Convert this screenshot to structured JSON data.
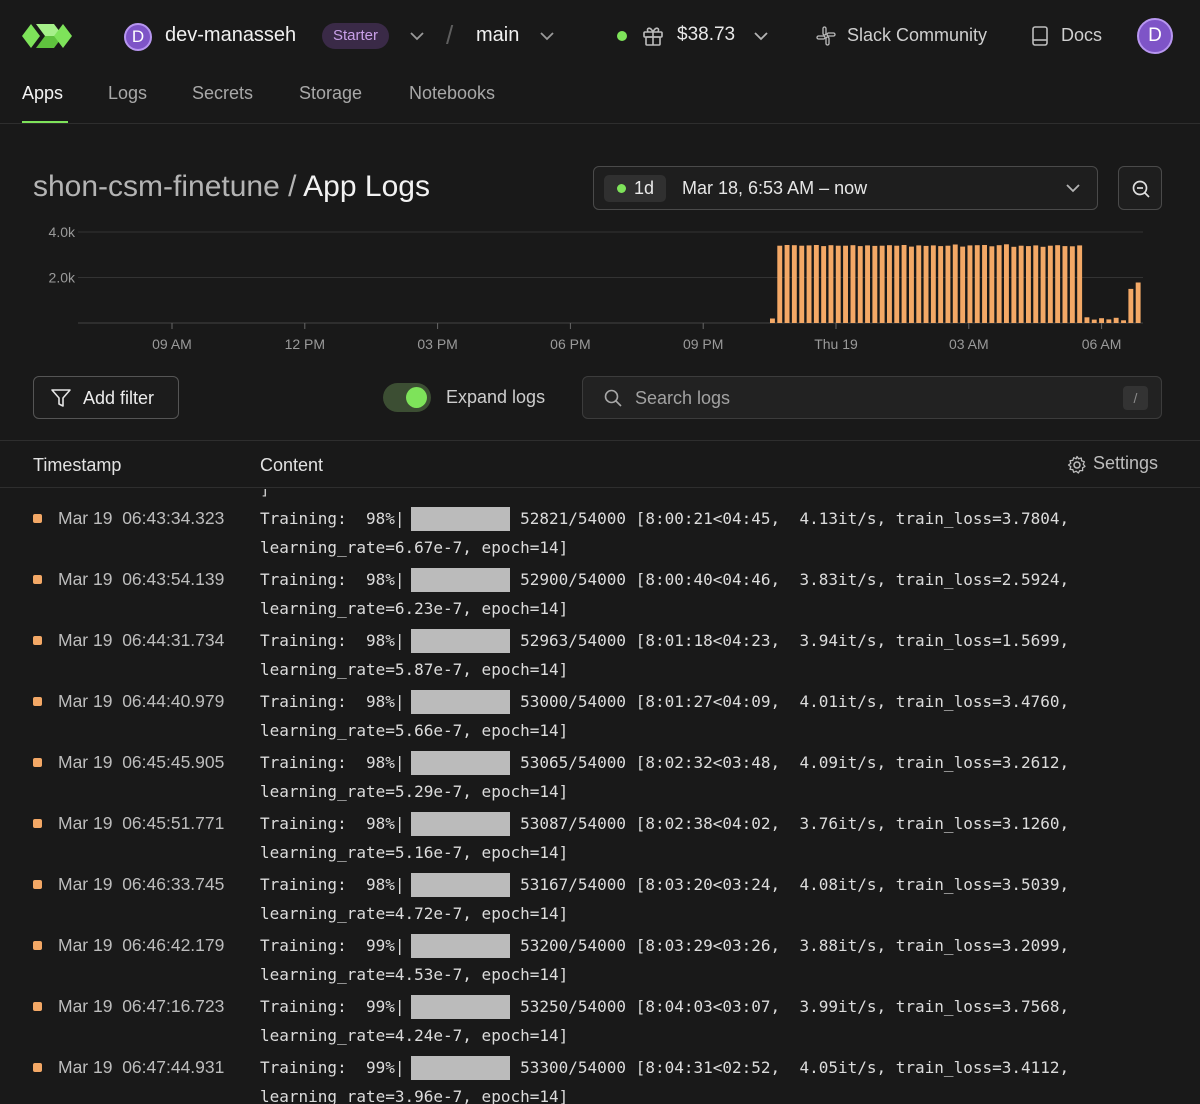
{
  "workspace": {
    "initial": "D",
    "name": "dev-manasseh",
    "plan_badge": "Starter"
  },
  "environment": {
    "separator": "/",
    "name": "main"
  },
  "credits": "$38.73",
  "links": {
    "slack": "Slack Community",
    "docs": "Docs"
  },
  "user": {
    "initial": "D"
  },
  "tabs": [
    "Apps",
    "Logs",
    "Secrets",
    "Storage",
    "Notebooks"
  ],
  "active_tab": "Apps",
  "page": {
    "app_name": "shon-csm-finetune",
    "separator": "/",
    "section": "App Logs"
  },
  "time_range": {
    "preset": "1d",
    "label": "Mar 18, 6:53 AM – now"
  },
  "chart_data": {
    "type": "bar",
    "y_ticks": [
      "4.0k",
      "2.0k"
    ],
    "x_ticks": [
      "09 AM",
      "12 PM",
      "03 PM",
      "06 PM",
      "09 PM",
      "Thu 19",
      "03 AM",
      "06 AM"
    ],
    "ylim": [
      0,
      4000
    ],
    "values": [
      200,
      3400,
      3430,
      3420,
      3400,
      3410,
      3430,
      3380,
      3420,
      3400,
      3400,
      3420,
      3380,
      3410,
      3390,
      3400,
      3420,
      3400,
      3430,
      3360,
      3410,
      3390,
      3410,
      3380,
      3400,
      3450,
      3360,
      3410,
      3420,
      3430,
      3370,
      3420,
      3460,
      3350,
      3400,
      3380,
      3410,
      3350,
      3400,
      3420,
      3380,
      3370,
      3410,
      250,
      150,
      210,
      160,
      230,
      120,
      1500,
      1780
    ],
    "color": "#f3a866",
    "grid": true
  },
  "filter": {
    "add_filter": "Add filter",
    "expand_logs": "Expand logs",
    "expand_on": true,
    "search_placeholder": "Search logs",
    "search_shortcut": "/"
  },
  "table": {
    "col_timestamp": "Timestamp",
    "col_content": "Content",
    "settings": "Settings"
  },
  "partial_line": "                                      ]",
  "logs": [
    {
      "ts": "Mar 19  06:43:34.323",
      "l1": "Training:  98%|          | 52821/54000 [8:00:21<04:45,  4.13it/s, train_loss=3.7804,",
      "l2": "learning_rate=6.67e-7, epoch=14]"
    },
    {
      "ts": "Mar 19  06:43:54.139",
      "l1": "Training:  98%|          | 52900/54000 [8:00:40<04:46,  3.83it/s, train_loss=2.5924,",
      "l2": "learning_rate=6.23e-7, epoch=14]"
    },
    {
      "ts": "Mar 19  06:44:31.734",
      "l1": "Training:  98%|          | 52963/54000 [8:01:18<04:23,  3.94it/s, train_loss=1.5699,",
      "l2": "learning_rate=5.87e-7, epoch=14]"
    },
    {
      "ts": "Mar 19  06:44:40.979",
      "l1": "Training:  98%|          | 53000/54000 [8:01:27<04:09,  4.01it/s, train_loss=3.4760,",
      "l2": "learning_rate=5.66e-7, epoch=14]"
    },
    {
      "ts": "Mar 19  06:45:45.905",
      "l1": "Training:  98%|          | 53065/54000 [8:02:32<03:48,  4.09it/s, train_loss=3.2612,",
      "l2": "learning_rate=5.29e-7, epoch=14]"
    },
    {
      "ts": "Mar 19  06:45:51.771",
      "l1": "Training:  98%|          | 53087/54000 [8:02:38<04:02,  3.76it/s, train_loss=3.1260,",
      "l2": "learning_rate=5.16e-7, epoch=14]"
    },
    {
      "ts": "Mar 19  06:46:33.745",
      "l1": "Training:  98%|          | 53167/54000 [8:03:20<03:24,  4.08it/s, train_loss=3.5039,",
      "l2": "learning_rate=4.72e-7, epoch=14]"
    },
    {
      "ts": "Mar 19  06:46:42.179",
      "l1": "Training:  99%|          | 53200/54000 [8:03:29<03:26,  3.88it/s, train_loss=3.2099,",
      "l2": "learning_rate=4.53e-7, epoch=14]"
    },
    {
      "ts": "Mar 19  06:47:16.723",
      "l1": "Training:  99%|          | 53250/54000 [8:04:03<03:07,  3.99it/s, train_loss=3.7568,",
      "l2": "learning_rate=4.24e-7, epoch=14]"
    },
    {
      "ts": "Mar 19  06:47:44.931",
      "l1": "Training:  99%|          | 53300/54000 [8:04:31<02:52,  4.05it/s, train_loss=3.4112,",
      "l2": "learning_rate=3.96e-7, epoch=14]"
    }
  ]
}
